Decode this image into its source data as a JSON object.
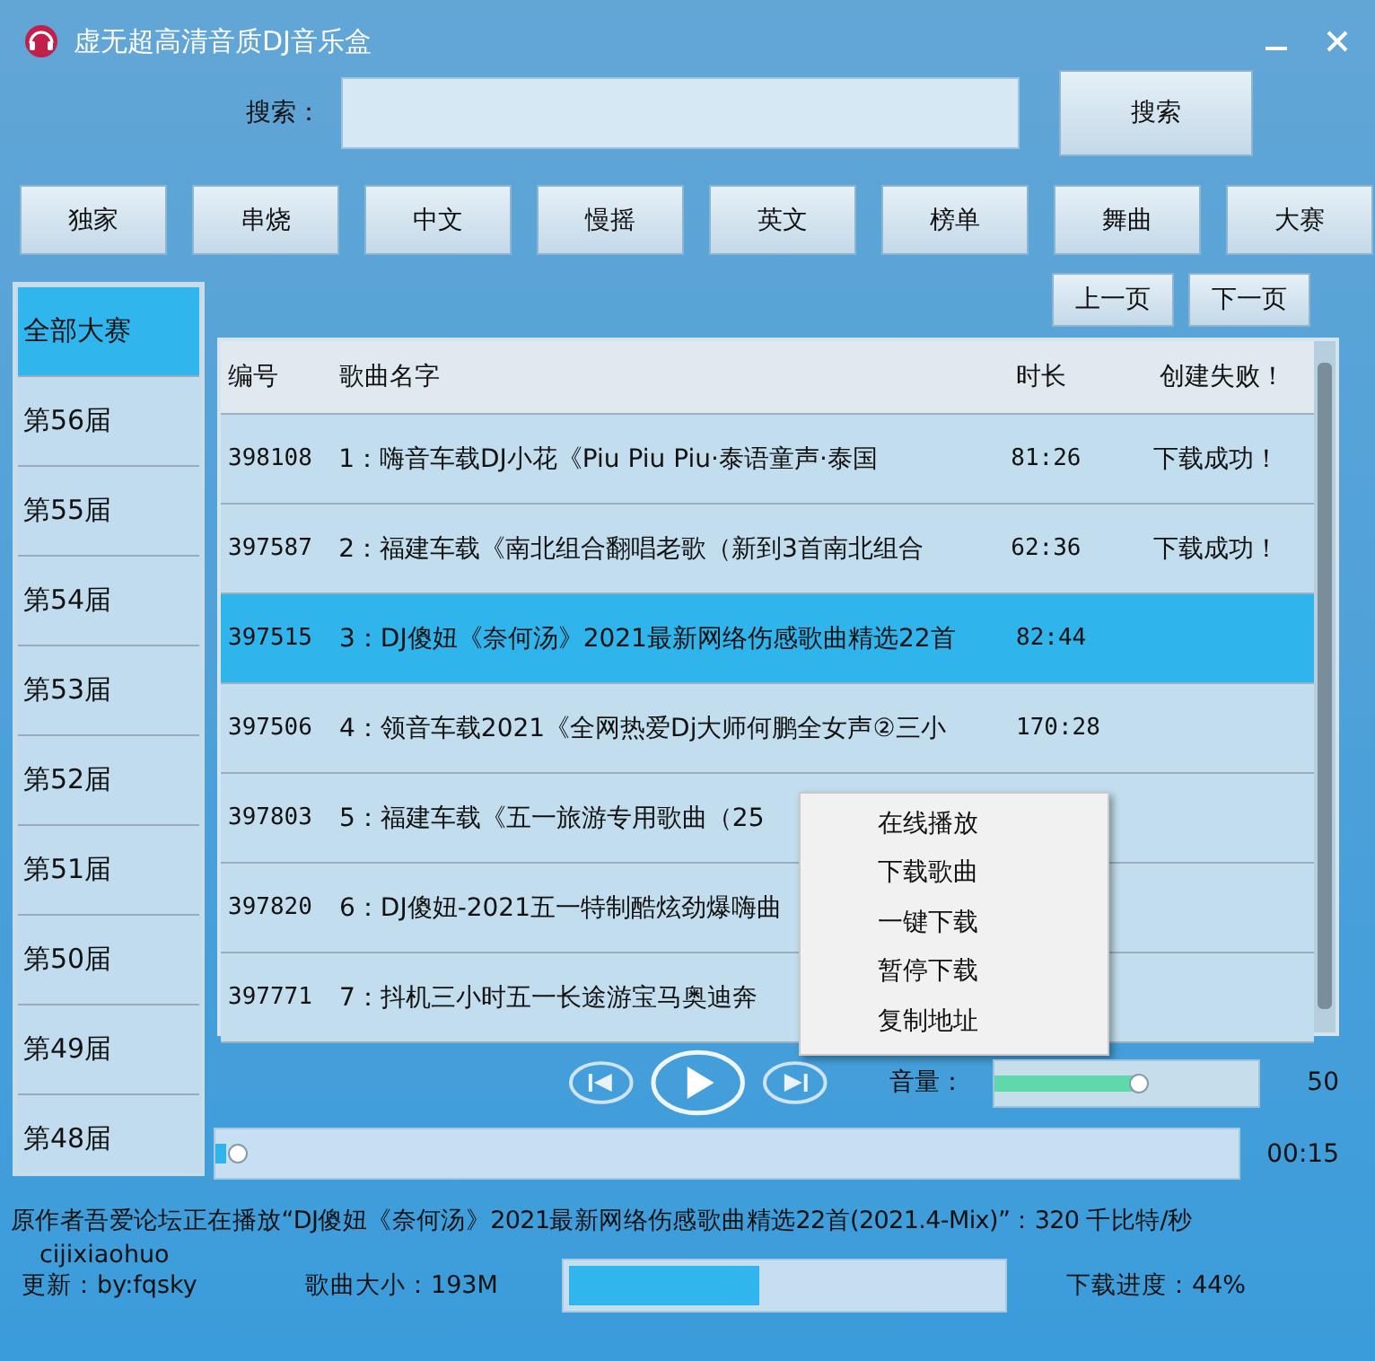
{
  "window": {
    "title": "虚无超高清音质DJ音乐盒"
  },
  "search": {
    "label": "搜索：",
    "button": "搜索"
  },
  "categories": [
    {
      "label": "独家"
    },
    {
      "label": "串烧"
    },
    {
      "label": "中文"
    },
    {
      "label": "慢摇"
    },
    {
      "label": "英文"
    },
    {
      "label": "榜单"
    },
    {
      "label": "舞曲"
    },
    {
      "label": "大赛"
    }
  ],
  "sidebar": {
    "items": [
      {
        "label": "全部大赛",
        "selected": true
      },
      {
        "label": "第56届",
        "selected": false
      },
      {
        "label": "第55届",
        "selected": false
      },
      {
        "label": "第54届",
        "selected": false
      },
      {
        "label": "第53届",
        "selected": false
      },
      {
        "label": "第52届",
        "selected": false
      },
      {
        "label": "第51届",
        "selected": false
      },
      {
        "label": "第50届",
        "selected": false
      },
      {
        "label": "第49届",
        "selected": false
      },
      {
        "label": "第48届",
        "selected": false
      }
    ]
  },
  "pager": {
    "prev": "上一页",
    "next": "下一页"
  },
  "table": {
    "columns": [
      "编号",
      "歌曲名字",
      "时长",
      "创建失败！"
    ],
    "rows": [
      {
        "id": "398108",
        "name": "1：嗨音车载DJ小花《Piu Piu Piu·泰语童声·泰国",
        "duration": "81:26",
        "status": "下载成功！",
        "selected": false
      },
      {
        "id": "397587",
        "name": "2：福建车载《南北组合翻唱老歌（新到3首南北组合",
        "duration": "62:36",
        "status": "下载成功！",
        "selected": false
      },
      {
        "id": "397515",
        "name": "3：DJ傻妞《奈何汤》2021最新网络伤感歌曲精选22首",
        "duration": "82:44",
        "selected": true
      },
      {
        "id": "397506",
        "name": "4：领音车载2021《全网热爱Dj大师何鹏全女声②三小",
        "duration": "170:28",
        "selected": false
      },
      {
        "id": "397803",
        "name": "5：福建车载《五一旅游专用歌曲（25",
        "selected": false
      },
      {
        "id": "397820",
        "name": "6：DJ傻妞-2021五一特制酷炫劲爆嗨曲",
        "selected": false
      },
      {
        "id": "397771",
        "name": "7：抖机三小时五一长途游宝马奥迪奔",
        "selected": false
      }
    ]
  },
  "context_menu": {
    "items": [
      "在线播放",
      "下载歌曲",
      "一键下载",
      "暂停下载",
      "复制地址"
    ]
  },
  "player": {
    "volume_label": "音量：",
    "volume": {
      "level": 0.55,
      "reading": "50"
    },
    "seek": {
      "level": 0.01
    },
    "time": "00:15"
  },
  "status": {
    "author": "原作者吾爱论坛",
    "now_playing": "正在播放“DJ傻妞《奈何汤》2021最新网络伤感歌曲精选22首(2021.4-Mix)”：320 千比特/秒",
    "author_name": "cijixiaohuo",
    "update": "更新：by:fqsky",
    "size": "歌曲大小：193M",
    "download": {
      "level": 0.44,
      "label": "下载进度：44%"
    }
  }
}
